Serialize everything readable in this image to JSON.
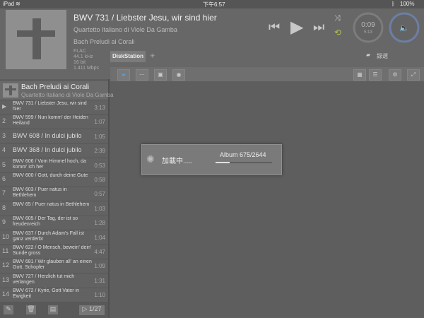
{
  "status": {
    "device": "iPad",
    "time": "下午6:57",
    "battery": "100%"
  },
  "now_playing": {
    "title": "BWV 731 / Liebster Jesu, wir sind hier",
    "artist": "Quartetto Italiano di Viole Da Gamba",
    "album": "Bach Preludi ai Corali",
    "format": [
      "FLAC",
      "44.1 kHz",
      "16 bit",
      "1.411 Mbps"
    ],
    "time_elapsed": "0:09",
    "time_total": "5:13"
  },
  "source": {
    "tab": "DiskStation",
    "folder_label": "錄選"
  },
  "playlist": {
    "album": "Bach Preludi ai Corali",
    "artist": "Quartetto Italiano di Viole Da Gamba",
    "tracks": [
      {
        "num": "",
        "title": "BWV 731 / Liebster Jesu, wir sind hier",
        "dur": "3:13"
      },
      {
        "num": "2",
        "title": "BWV 599 / Nun komm' der Heiden Heiland",
        "dur": "1:07"
      },
      {
        "num": "3",
        "title": "BWV 608 / In dulci jubilo",
        "dur": "1:05"
      },
      {
        "num": "4",
        "title": "BWV 368 / In dulci jubilo",
        "dur": "2:39"
      },
      {
        "num": "5",
        "title": "BWV 606 / Vom Himmel hoch, da komm' ich her",
        "dur": "0:53"
      },
      {
        "num": "6",
        "title": "BWV 600 / Gott, durch deine Gute",
        "dur": "0:58"
      },
      {
        "num": "7",
        "title": "BWV 603 / Puer natus in Bethlehem",
        "dur": "0:57"
      },
      {
        "num": "8",
        "title": "BWV 65 / Puer natus in Bethlehem",
        "dur": "1:03"
      },
      {
        "num": "9",
        "title": "BWV 605 / Der Tag, der ist so freudenreich",
        "dur": "1:28"
      },
      {
        "num": "10",
        "title": "BWV 637 / Durch Adam's Fall ist ganz verderbt",
        "dur": "1:04"
      },
      {
        "num": "11",
        "title": "BWV 622 / O Mensch, bewein' dein' Sunde gross",
        "dur": "4:47"
      },
      {
        "num": "12",
        "title": "BWV 681 / Wir glauben all' an einen Gott, Schopfer",
        "dur": "1:09"
      },
      {
        "num": "13",
        "title": "BWV 727 / Herzlich tut mich verlangen",
        "dur": "1:31"
      },
      {
        "num": "14",
        "title": "BWV 672 / Kyrie, Gott Vater in Ewigkeit",
        "dur": "1:10"
      }
    ],
    "position": "1/27"
  },
  "loading": {
    "text": "加載中.....",
    "progress_label": "Album 675/2644",
    "progress": 0.255
  }
}
